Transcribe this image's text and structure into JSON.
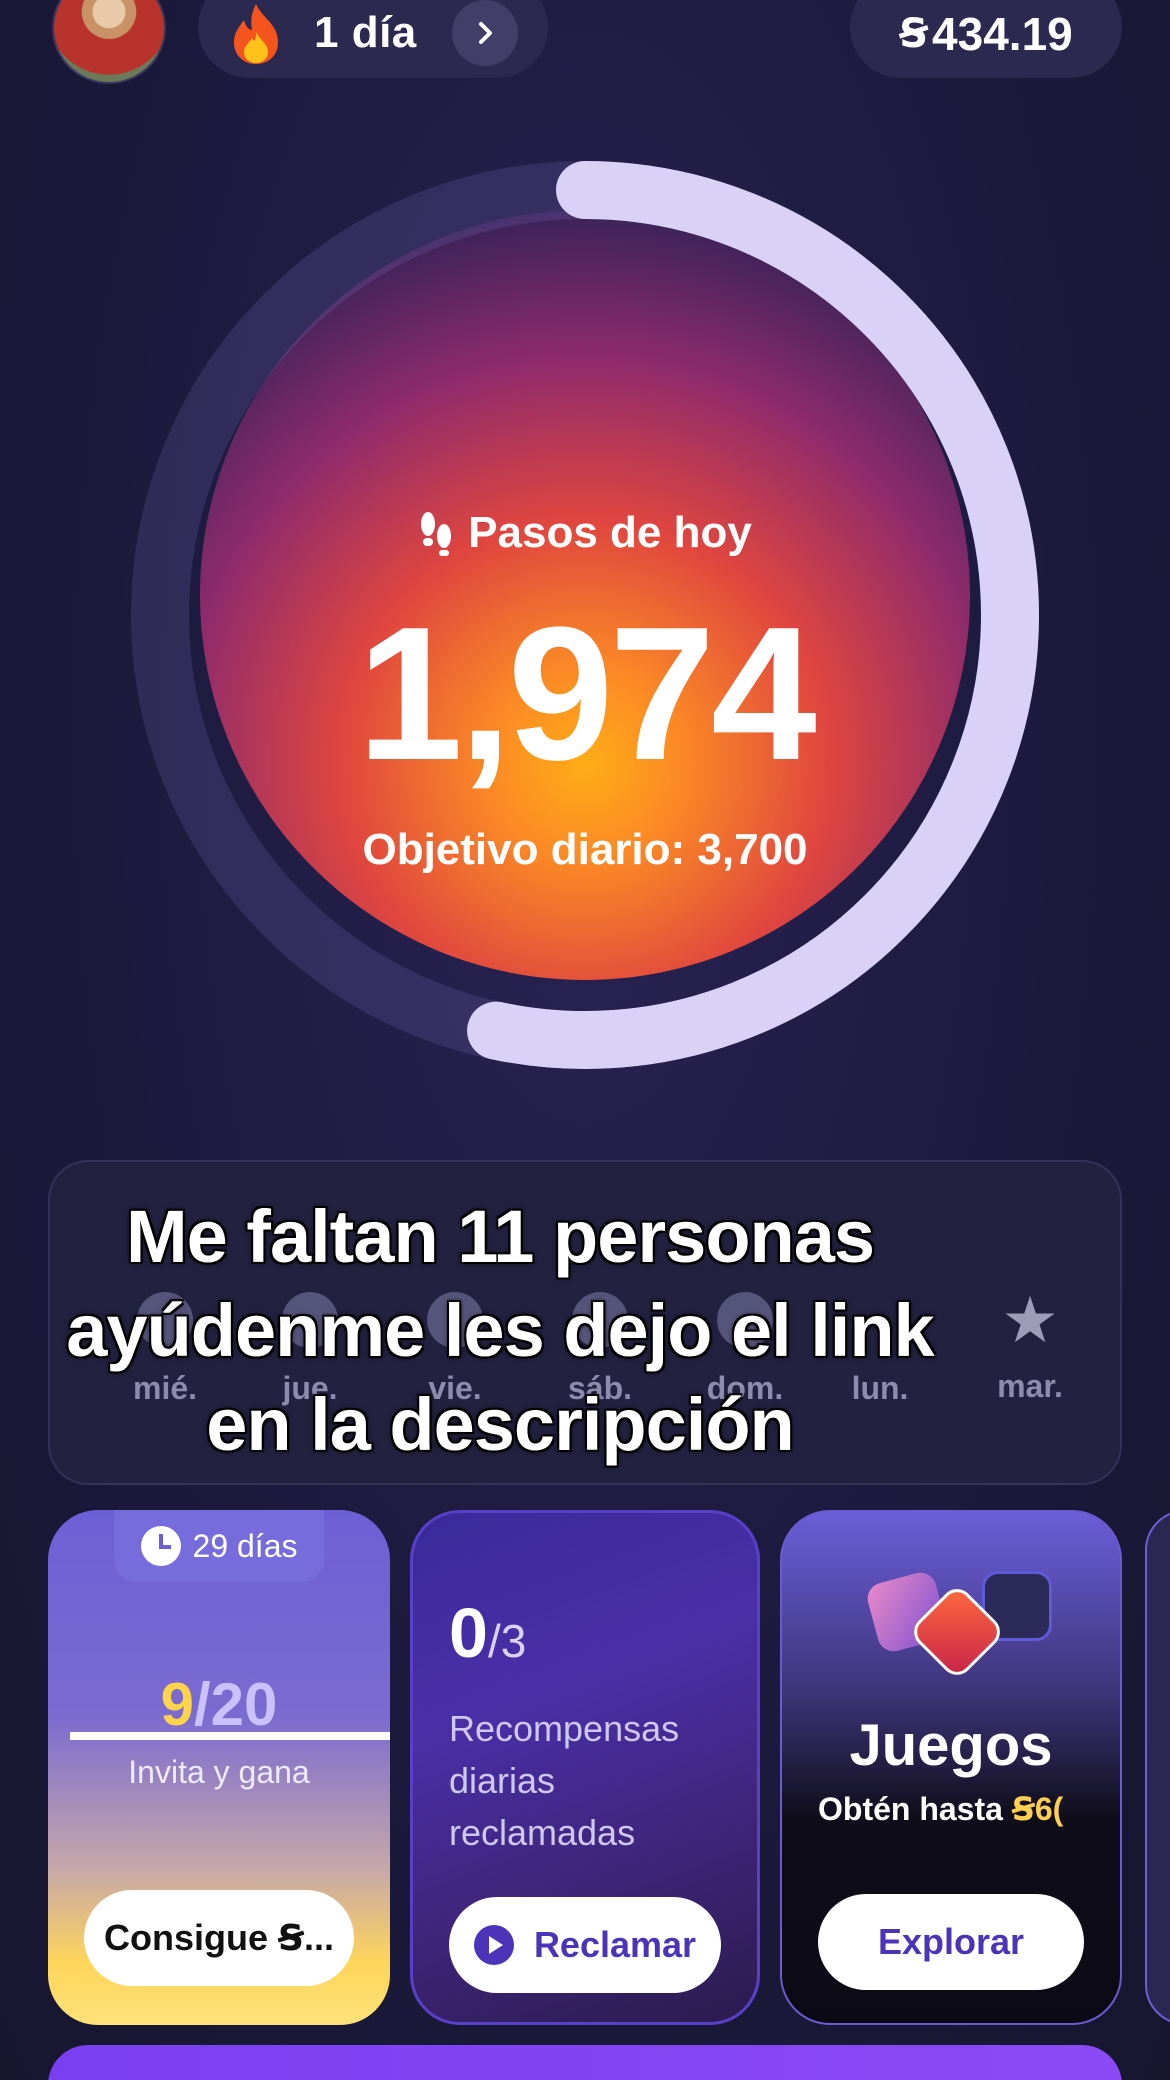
{
  "header": {
    "streak_label": "1 día",
    "balance": "434.19",
    "coin_symbol": "Ꞩ"
  },
  "steps": {
    "label": "Pasos de hoy",
    "value": "1,974",
    "goal_text": "Objetivo diario: 3,700",
    "progress_fraction": 0.5335
  },
  "week": {
    "days": [
      "mié.",
      "jue.",
      "vie.",
      "sáb.",
      "dom.",
      "lun.",
      "mar."
    ]
  },
  "caption": {
    "line1": "Me faltan 11 personas",
    "line2": "ayúdenme les dejo el link",
    "line3": "en la descripción"
  },
  "cards": {
    "invite": {
      "timer": "29 días",
      "current": "9",
      "separator": "/",
      "total": "20",
      "label": "Invita y gana",
      "button": "Consigue Ꞩ..."
    },
    "daily": {
      "current": "0",
      "total": "/3",
      "text": "Recompensas diarias reclamadas",
      "button": "Reclamar"
    },
    "games": {
      "title": "Juegos",
      "subtitle_prefix": "Obtén hasta ",
      "subtitle_amount": "Ꞩ6(",
      "button": "Explorar"
    }
  },
  "colors": {
    "background": "#1b1a3a",
    "accent_purple": "#4b34b8",
    "accent_yellow": "#ffd44a"
  }
}
